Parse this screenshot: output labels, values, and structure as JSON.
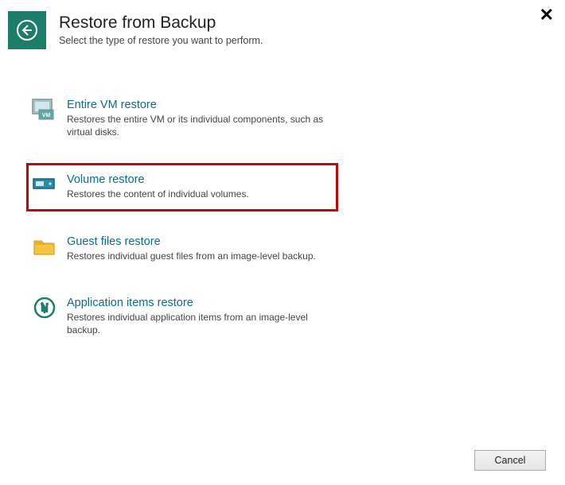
{
  "header": {
    "title": "Restore from Backup",
    "subtitle": "Select the type of restore you want to perform."
  },
  "options": [
    {
      "title": "Entire VM restore",
      "desc": "Restores the entire VM or its individual components, such as virtual disks.",
      "highlighted": false
    },
    {
      "title": "Volume restore",
      "desc": "Restores the content of individual volumes.",
      "highlighted": true
    },
    {
      "title": "Guest files restore",
      "desc": "Restores individual guest files from an image-level backup.",
      "highlighted": false
    },
    {
      "title": "Application items restore",
      "desc": "Restores individual application items from an image-level backup.",
      "highlighted": false
    }
  ],
  "footer": {
    "cancel_label": "Cancel"
  }
}
